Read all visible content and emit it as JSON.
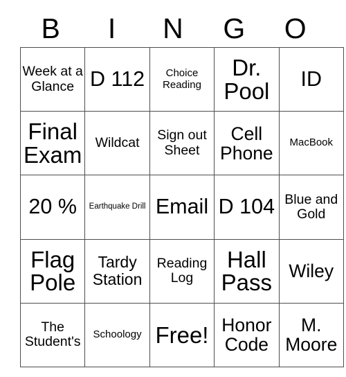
{
  "card": {
    "title_letters": [
      "B",
      "I",
      "N",
      "G",
      "O"
    ],
    "border_color": "#4d4d4d",
    "text_color": "#000000",
    "background_color": "#ffffff",
    "rows": 5,
    "columns": 5,
    "cells": [
      [
        {
          "text": "Week at a Glance",
          "size": "md"
        },
        {
          "text": "D 112",
          "size": "xxl"
        },
        {
          "text": "Choice Reading",
          "size": "sm"
        },
        {
          "text": "Dr. Pool",
          "size": "max"
        },
        {
          "text": "ID",
          "size": "xxl"
        }
      ],
      [
        {
          "text": "Final Exam",
          "size": "max"
        },
        {
          "text": "Wildcat",
          "size": "md"
        },
        {
          "text": "Sign out Sheet",
          "size": "md"
        },
        {
          "text": "Cell Phone",
          "size": "xl"
        },
        {
          "text": "MacBook",
          "size": "sm"
        }
      ],
      [
        {
          "text": "20 %",
          "size": "xxl"
        },
        {
          "text": "Earthquake Drill",
          "size": "xs"
        },
        {
          "text": "Email",
          "size": "xxl"
        },
        {
          "text": "D 104",
          "size": "xxl"
        },
        {
          "text": "Blue and Gold",
          "size": "md"
        }
      ],
      [
        {
          "text": "Flag Pole",
          "size": "max"
        },
        {
          "text": "Tardy Station",
          "size": "lg"
        },
        {
          "text": "Reading Log",
          "size": "md"
        },
        {
          "text": "Hall Pass",
          "size": "max"
        },
        {
          "text": "Wiley",
          "size": "xl"
        }
      ],
      [
        {
          "text": "The Student's",
          "size": "md"
        },
        {
          "text": "Schoology",
          "size": "sm"
        },
        {
          "text": "Free!",
          "size": "max"
        },
        {
          "text": "Honor Code",
          "size": "xl"
        },
        {
          "text": "M. Moore",
          "size": "xl"
        }
      ]
    ]
  }
}
